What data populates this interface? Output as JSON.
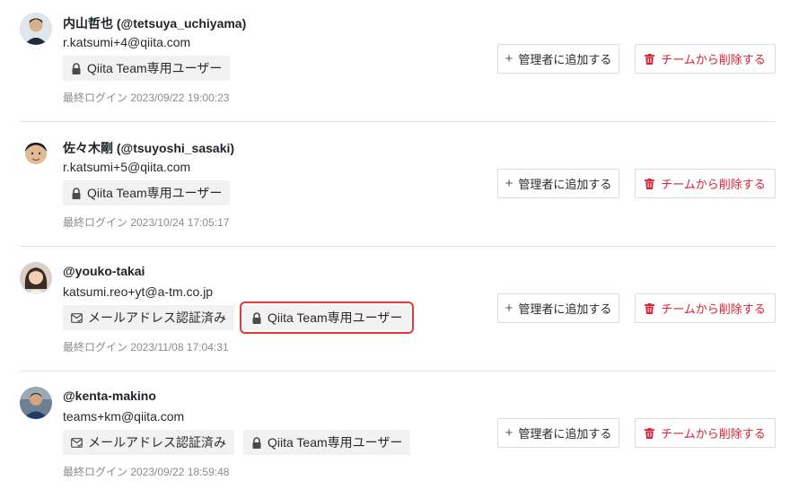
{
  "members": [
    {
      "display_name": "内山哲也 (@tetsuya_uchiyama)",
      "email": "r.katsumi+4@qiita.com",
      "badges": {
        "team_user": "Qiita Team専用ユーザー"
      },
      "last_login": "最終ログイン 2023/09/22 19:00:23",
      "add_admin_label": "管理者に追加する",
      "remove_label": "チームから削除する"
    },
    {
      "display_name": "佐々木剛 (@tsuyoshi_sasaki)",
      "email": "r.katsumi+5@qiita.com",
      "badges": {
        "team_user": "Qiita Team専用ユーザー"
      },
      "last_login": "最終ログイン 2023/10/24 17:05:17",
      "add_admin_label": "管理者に追加する",
      "remove_label": "チームから削除する"
    },
    {
      "display_name": "@youko-takai",
      "email": "katsumi.reo+yt@a-tm.co.jp",
      "badges": {
        "email_verified": "メールアドレス認証済み",
        "team_user": "Qiita Team専用ユーザー"
      },
      "last_login": "最終ログイン 2023/11/08 17:04:31",
      "add_admin_label": "管理者に追加する",
      "remove_label": "チームから削除する"
    },
    {
      "display_name": "@kenta-makino",
      "email": "teams+km@qiita.com",
      "badges": {
        "email_verified": "メールアドレス認証済み",
        "team_user": "Qiita Team専用ユーザー"
      },
      "last_login": "最終ログイン 2023/09/22 18:59:48",
      "add_admin_label": "管理者に追加する",
      "remove_label": "チームから削除する"
    }
  ],
  "icons": {
    "lock": "lock-icon",
    "mail": "mail-check-icon",
    "plus": "plus-icon",
    "trash": "trash-icon"
  },
  "colors": {
    "danger": "#d92334",
    "highlight": "#e53935",
    "badge_bg": "#f2f2f2"
  }
}
